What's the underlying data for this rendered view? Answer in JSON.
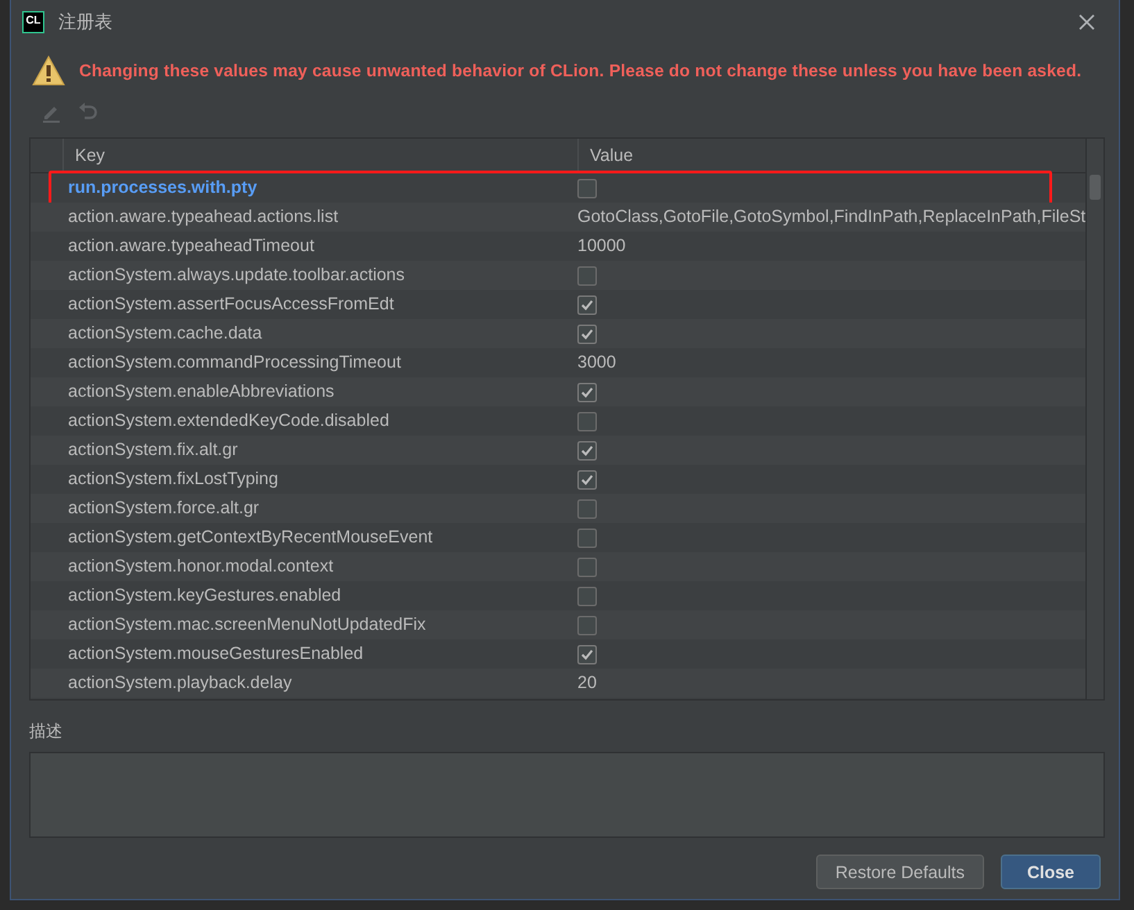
{
  "window": {
    "logo": "CL",
    "title": "注册表"
  },
  "warning": "Changing these values may cause unwanted behavior of CLion. Please do not change these unless you have been asked.",
  "toolbar": [
    {
      "kind": "edit",
      "disabled": true
    },
    {
      "kind": "revert",
      "disabled": true
    }
  ],
  "table": {
    "columns": [
      "Key",
      "Value"
    ],
    "rows": [
      {
        "key": "run.processes.with.pty",
        "kind": "checkbox",
        "checked": false,
        "modified": true,
        "annotated": true
      },
      {
        "key": "action.aware.typeahead.actions.list",
        "kind": "text",
        "value": "GotoClass,GotoFile,GotoSymbol,FindInPath,ReplaceInPath,FileSt",
        "modified": false
      },
      {
        "key": "action.aware.typeaheadTimeout",
        "kind": "text",
        "value": "10000",
        "modified": false
      },
      {
        "key": "actionSystem.always.update.toolbar.actions",
        "kind": "checkbox",
        "checked": false,
        "modified": false
      },
      {
        "key": "actionSystem.assertFocusAccessFromEdt",
        "kind": "checkbox",
        "checked": true,
        "modified": false
      },
      {
        "key": "actionSystem.cache.data",
        "kind": "checkbox",
        "checked": true,
        "modified": false
      },
      {
        "key": "actionSystem.commandProcessingTimeout",
        "kind": "text",
        "value": "3000",
        "modified": false
      },
      {
        "key": "actionSystem.enableAbbreviations",
        "kind": "checkbox",
        "checked": true,
        "modified": false
      },
      {
        "key": "actionSystem.extendedKeyCode.disabled",
        "kind": "checkbox",
        "checked": false,
        "modified": false
      },
      {
        "key": "actionSystem.fix.alt.gr",
        "kind": "checkbox",
        "checked": true,
        "modified": false
      },
      {
        "key": "actionSystem.fixLostTyping",
        "kind": "checkbox",
        "checked": true,
        "modified": false
      },
      {
        "key": "actionSystem.force.alt.gr",
        "kind": "checkbox",
        "checked": false,
        "modified": false
      },
      {
        "key": "actionSystem.getContextByRecentMouseEvent",
        "kind": "checkbox",
        "checked": false,
        "modified": false
      },
      {
        "key": "actionSystem.honor.modal.context",
        "kind": "checkbox",
        "checked": false,
        "modified": false
      },
      {
        "key": "actionSystem.keyGestures.enabled",
        "kind": "checkbox",
        "checked": false,
        "modified": false
      },
      {
        "key": "actionSystem.mac.screenMenuNotUpdatedFix",
        "kind": "checkbox",
        "checked": false,
        "modified": false
      },
      {
        "key": "actionSystem.mouseGesturesEnabled",
        "kind": "checkbox",
        "checked": true,
        "modified": false
      },
      {
        "key": "actionSystem.playback.delay",
        "kind": "text",
        "value": "20",
        "modified": false
      }
    ]
  },
  "description": {
    "label": "描述"
  },
  "buttons": [
    {
      "label": "Restore Defaults",
      "default": false
    },
    {
      "label": "Close",
      "default": true
    }
  ]
}
